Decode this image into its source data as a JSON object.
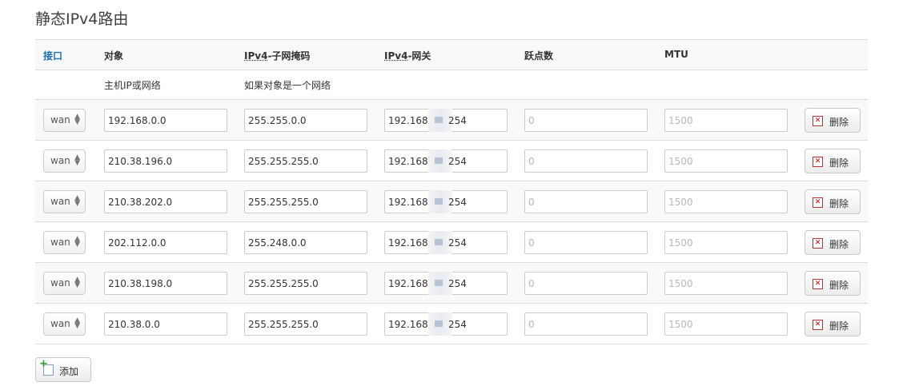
{
  "page": {
    "title": "静态IPv4路由"
  },
  "header": {
    "interface": "接口",
    "target": "对象",
    "netmask_abbr": "IPv4",
    "netmask_rest": "-子网掩码",
    "gateway_abbr": "IPv4",
    "gateway_rest": "-网关",
    "metric": "跃点数",
    "mtu": "MTU"
  },
  "descriptions": {
    "target": "主机IP或网络",
    "netmask": "如果对象是一个网络"
  },
  "rows": [
    {
      "iface": "wan",
      "target": "192.168.0.0",
      "netmask": "255.255.0.0",
      "gw_head": "192.168",
      "gw_tail": "254",
      "metric": "0",
      "mtu": "1500",
      "delete": "删除"
    },
    {
      "iface": "wan",
      "target": "210.38.196.0",
      "netmask": "255.255.255.0",
      "gw_head": "192.168.",
      "gw_tail": "254",
      "metric": "0",
      "mtu": "1500",
      "delete": "删除"
    },
    {
      "iface": "wan",
      "target": "210.38.202.0",
      "netmask": "255.255.255.0",
      "gw_head": "192.168.1",
      "gw_tail": "254",
      "metric": "0",
      "mtu": "1500",
      "delete": "删除"
    },
    {
      "iface": "wan",
      "target": "202.112.0.0",
      "netmask": "255.248.0.0",
      "gw_head": "192.168",
      "gw_tail": "254",
      "metric": "0",
      "mtu": "1500",
      "delete": "删除"
    },
    {
      "iface": "wan",
      "target": "210.38.198.0",
      "netmask": "255.255.255.0",
      "gw_head": "192.168",
      "gw_tail": "254",
      "metric": "0",
      "mtu": "1500",
      "delete": "删除"
    },
    {
      "iface": "wan",
      "target": "210.38.0.0",
      "netmask": "255.255.255.0",
      "gw_head": "192.168",
      "gw_tail": "254",
      "metric": "0",
      "mtu": "1500",
      "delete": "删除"
    }
  ],
  "actions": {
    "add": "添加"
  },
  "icons": {
    "select_arrows": "up-down-arrows-icon",
    "delete": "delete-icon",
    "add": "add-icon"
  },
  "colors": {
    "sorted_header": "#1e6fb9"
  }
}
